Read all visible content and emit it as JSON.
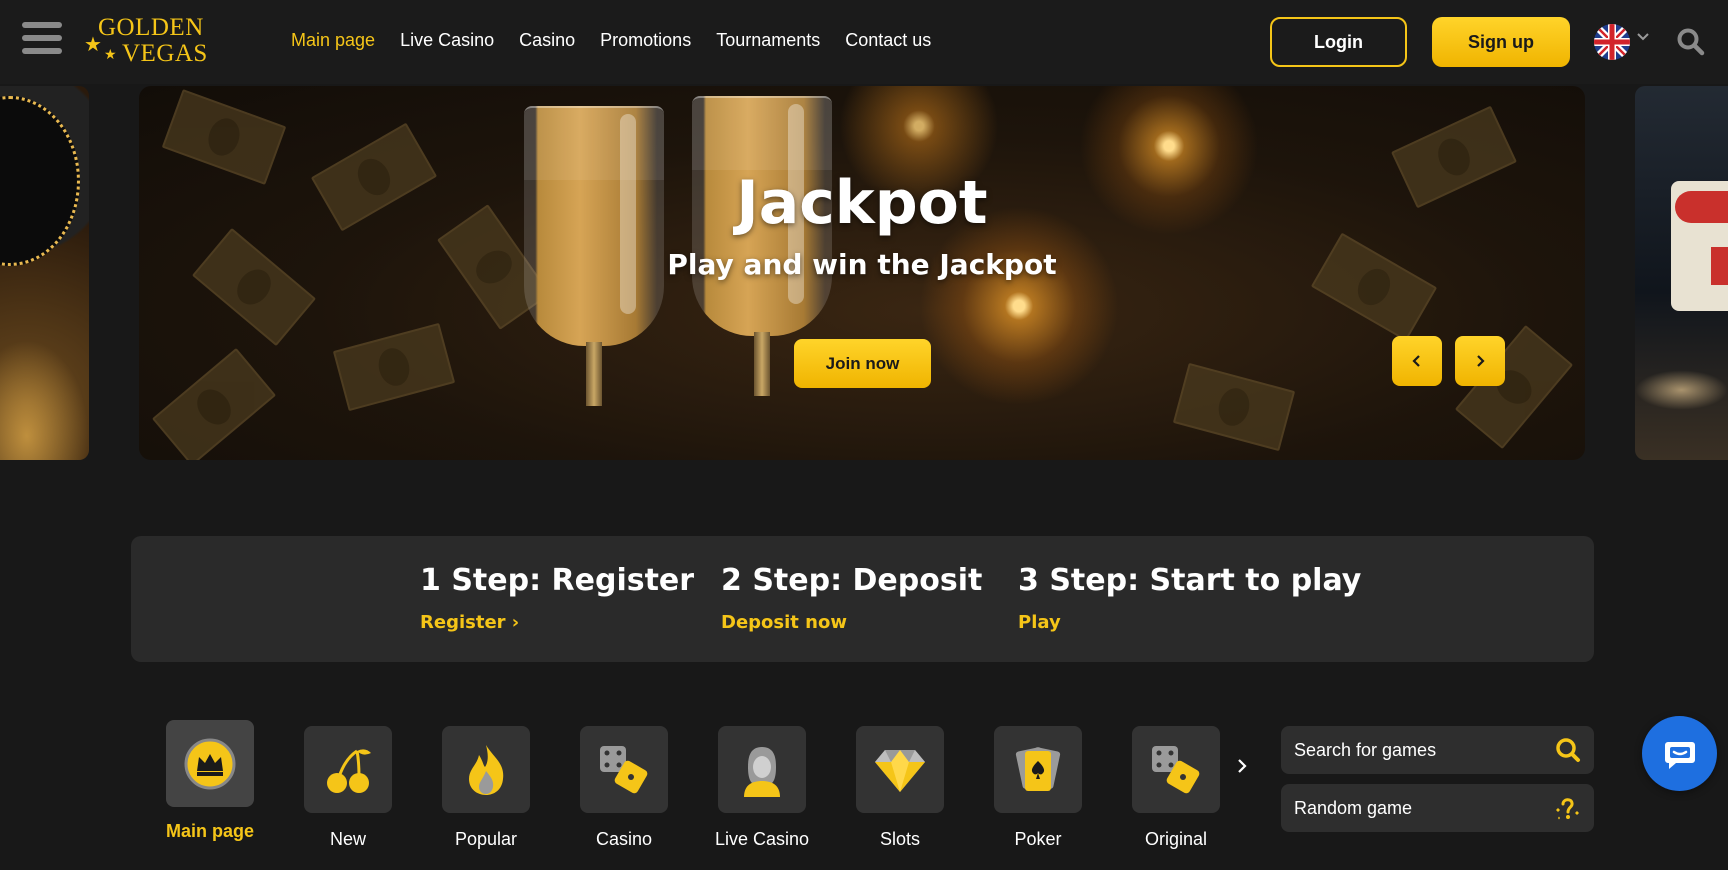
{
  "header": {
    "logo": {
      "line1": "GOLDEN",
      "line2": "VEGAS"
    },
    "nav": [
      {
        "label": "Main page",
        "active": true
      },
      {
        "label": "Live Casino"
      },
      {
        "label": "Casino"
      },
      {
        "label": "Promotions"
      },
      {
        "label": "Tournaments"
      },
      {
        "label": "Contact us"
      }
    ],
    "login_label": "Login",
    "signup_label": "Sign up",
    "language_icon": "uk-flag-icon"
  },
  "banner": {
    "title": "Jackpot",
    "subtitle": "Play and win the Jackpot",
    "cta_label": "Join now",
    "prev_symbol": "‹",
    "next_symbol": "›"
  },
  "steps": [
    {
      "title": "1 Step: Register",
      "link": "Register ›"
    },
    {
      "title": "2 Step: Deposit",
      "link": "Deposit now"
    },
    {
      "title": "3 Step: Start to play",
      "link": "Play"
    }
  ],
  "categories": [
    {
      "label": "Main page",
      "icon": "crown-icon",
      "active": true
    },
    {
      "label": "New",
      "icon": "cherry-icon"
    },
    {
      "label": "Popular",
      "icon": "fire-icon"
    },
    {
      "label": "Casino",
      "icon": "dice-icon"
    },
    {
      "label": "Live Casino",
      "icon": "dealer-icon"
    },
    {
      "label": "Slots",
      "icon": "diamond-icon"
    },
    {
      "label": "Poker",
      "icon": "cards-icon"
    },
    {
      "label": "Original",
      "icon": "dice-icon"
    }
  ],
  "sidebar_tools": {
    "search_placeholder": "Search for games",
    "random_label": "Random game"
  },
  "colors": {
    "accent": "#f5c518",
    "background": "#181818",
    "panel": "#2a2a2a",
    "chat": "#1e6fe0"
  }
}
